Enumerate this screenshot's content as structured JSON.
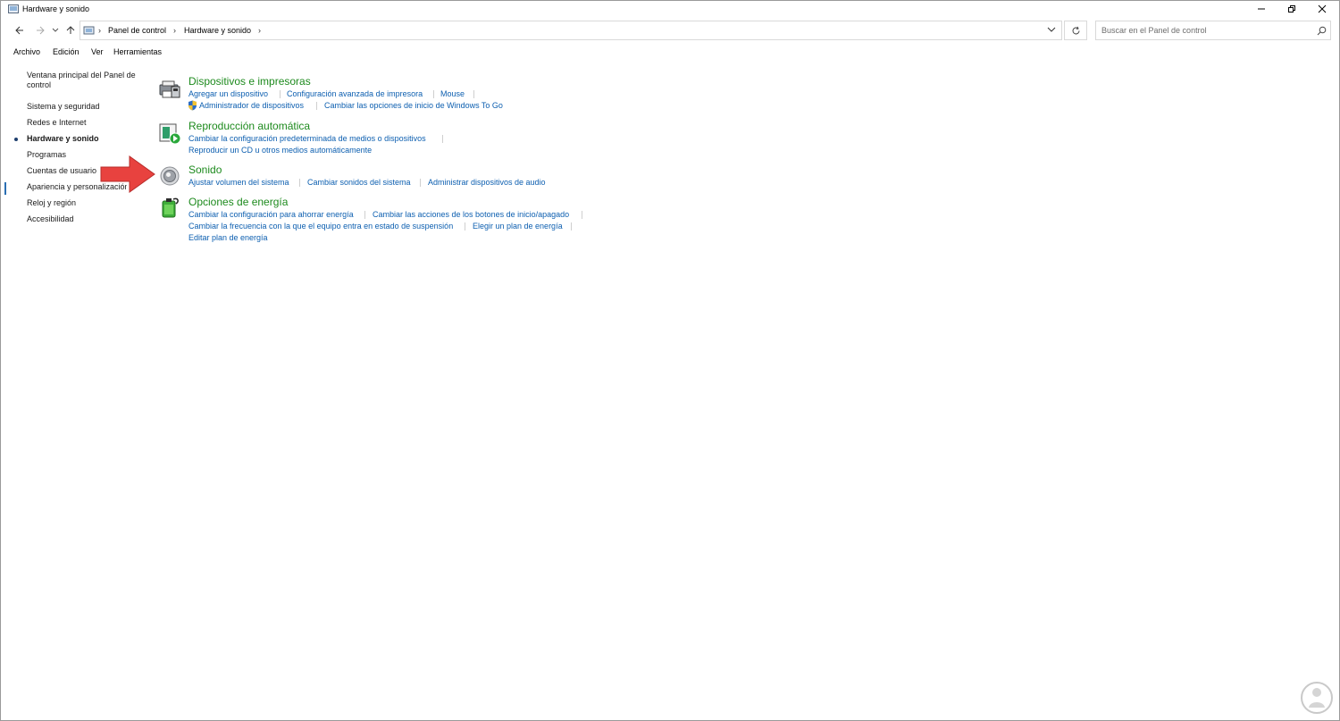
{
  "window": {
    "title": "Hardware y sonido"
  },
  "address": {
    "crumbs": [
      "Panel de control",
      "Hardware y sonido"
    ]
  },
  "search": {
    "placeholder": "Buscar en el Panel de control"
  },
  "menu": [
    "Archivo",
    "Edición",
    "Ver",
    "Herramientas"
  ],
  "sidebar": {
    "home": "Ventana principal del Panel de control",
    "items": [
      "Sistema y seguridad",
      "Redes e Internet",
      "Hardware y sonido",
      "Programas",
      "Cuentas de usuario",
      "Apariencia y personalización",
      "Reloj y región",
      "Accesibilidad"
    ],
    "active_index": 2
  },
  "sections": {
    "devices": {
      "title": "Dispositivos e impresoras",
      "links": [
        "Agregar un dispositivo",
        "Configuración avanzada de impresora",
        "Mouse",
        "Administrador de dispositivos",
        "Cambiar las opciones de inicio de Windows To Go"
      ]
    },
    "autoplay": {
      "title": "Reproducción automática",
      "links": [
        "Cambiar la configuración predeterminada de medios o dispositivos",
        "Reproducir un CD u otros medios automáticamente"
      ]
    },
    "sound": {
      "title": "Sonido",
      "links": [
        "Ajustar volumen del sistema",
        "Cambiar sonidos del sistema",
        "Administrar dispositivos de audio"
      ]
    },
    "power": {
      "title": "Opciones de energía",
      "links": [
        "Cambiar la configuración para ahorrar energía",
        "Cambiar las acciones de los botones de inicio/apagado",
        "Cambiar la frecuencia con la que el equipo entra en estado de suspensión",
        "Elegir un plan de energía",
        "Editar plan de energía"
      ]
    }
  },
  "colors": {
    "section_title": "#1d8a1d",
    "link": "#0d5fb0",
    "arrow": "#e8423f"
  }
}
